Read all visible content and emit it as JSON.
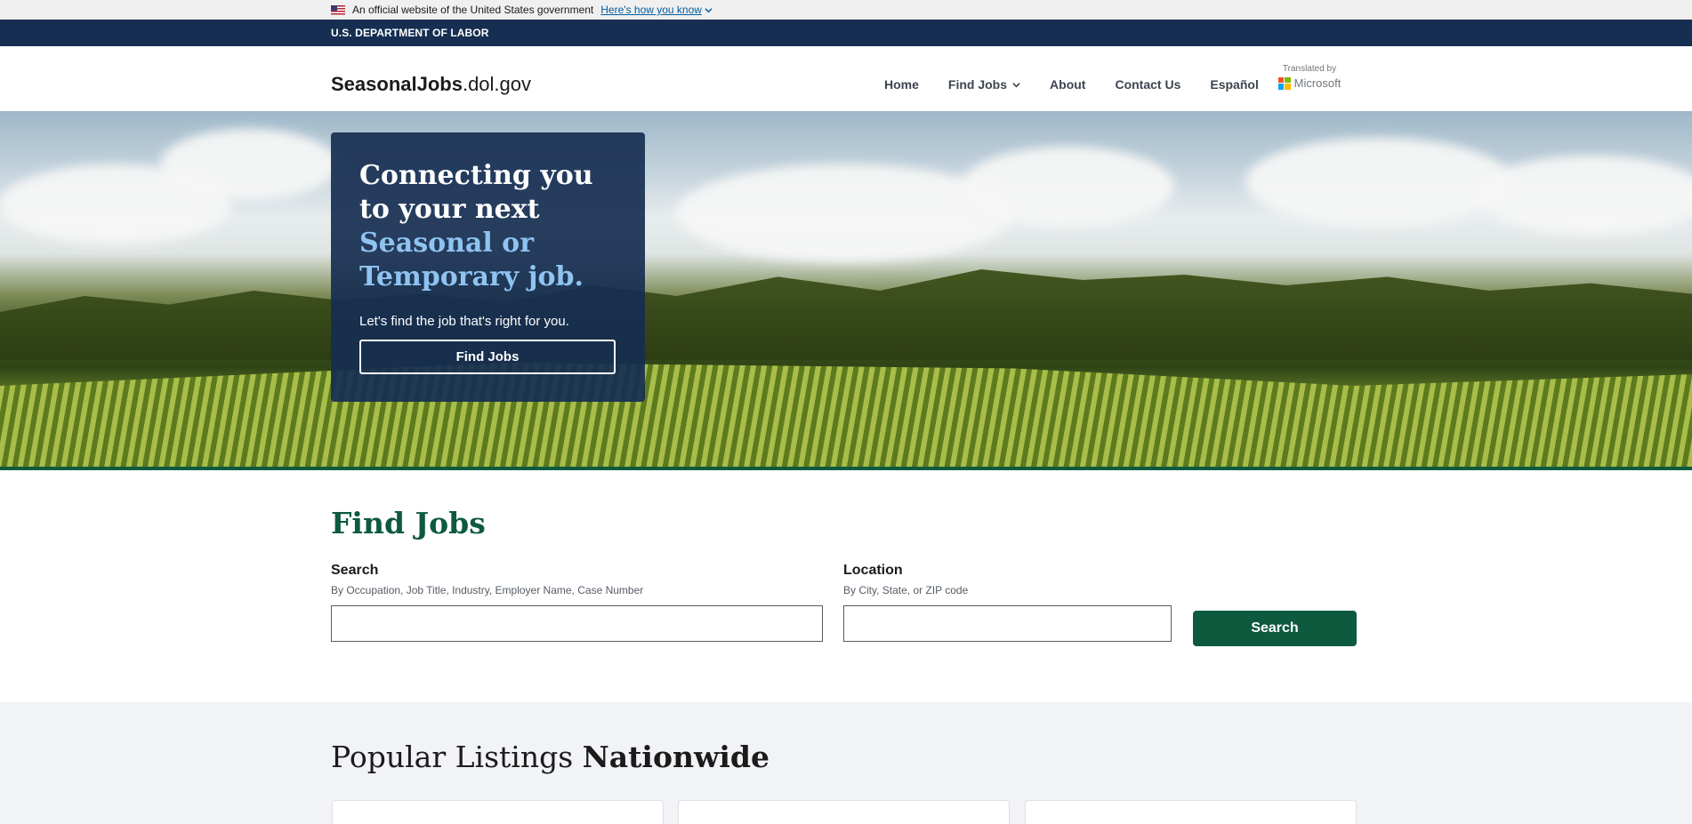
{
  "gov_banner": {
    "text": "An official website of the United States government",
    "link": "Here's how you know"
  },
  "agency_bar": {
    "text": "U.S. DEPARTMENT OF LABOR"
  },
  "header": {
    "logo_bold": "SeasonalJobs",
    "logo_rest": ".dol.gov",
    "nav": [
      "Home",
      "Find Jobs",
      "About",
      "Contact Us",
      "Español"
    ],
    "translated_by": "Translated by",
    "translator": "Microsoft"
  },
  "hero": {
    "heading_line1": "Connecting you to your next",
    "heading_accent": "Seasonal or Temporary job.",
    "subtext": "Let's find the job that's right for you.",
    "button": "Find Jobs"
  },
  "find_jobs": {
    "title": "Find Jobs",
    "search_label": "Search",
    "search_hint": "By Occupation, Job Title, Industry, Employer Name, Case Number",
    "search_value": "",
    "location_label": "Location",
    "location_hint": "By City, State, or ZIP code",
    "location_value": "",
    "button": "Search"
  },
  "popular": {
    "title_regular": "Popular Listings",
    "title_bold": "Nationwide"
  },
  "colors": {
    "navy": "#162e51",
    "green": "#0e5a3f",
    "accent_blue": "#8fc3f0",
    "light_gray": "#f1f3f6"
  }
}
